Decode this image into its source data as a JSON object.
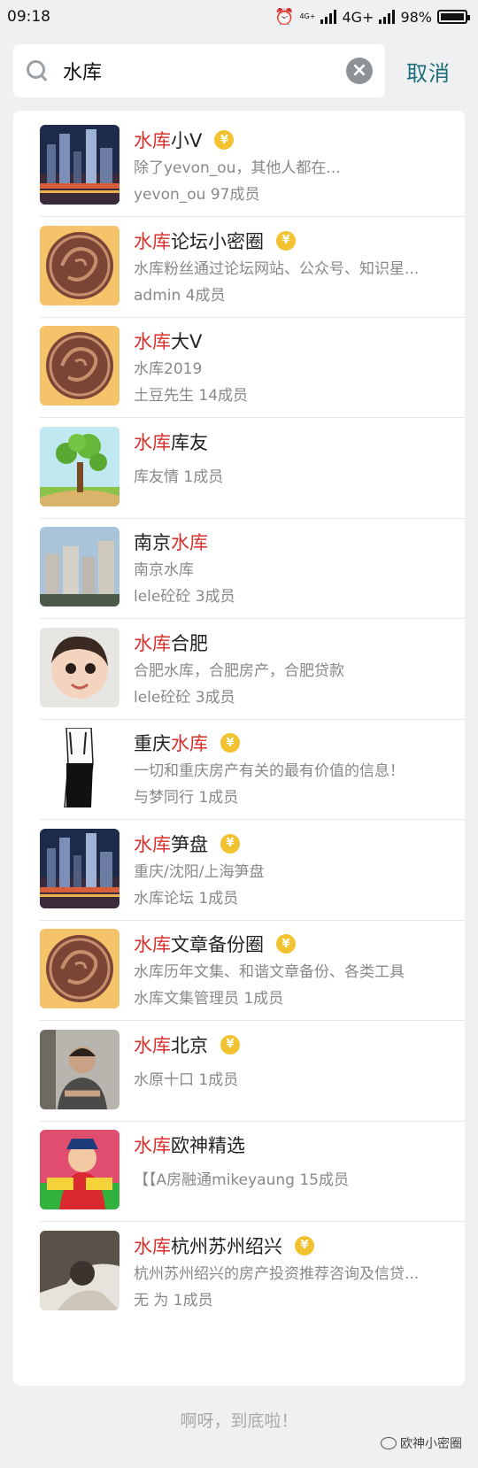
{
  "status_bar": {
    "time": "09:18",
    "network_small": "4G+",
    "network": "4G+",
    "battery": "98%"
  },
  "search": {
    "value": "水库",
    "cancel_label": "取消"
  },
  "items": [
    {
      "highlight": "水库",
      "title_rest": "小V",
      "prefix": "",
      "verified": true,
      "desc": "除了yevon_ou，其他人都在...",
      "meta": "yevon_ou 97成员"
    },
    {
      "highlight": "水库",
      "title_rest": "论坛小密圈",
      "prefix": "",
      "verified": true,
      "desc": "水库粉丝通过论坛网站、公众号、知识星...",
      "meta": "admin 4成员"
    },
    {
      "highlight": "水库",
      "title_rest": "大V",
      "prefix": "",
      "verified": false,
      "desc": "水库2019",
      "meta": "土豆先生 14成员"
    },
    {
      "highlight": "水库",
      "title_rest": "库友",
      "prefix": "",
      "verified": false,
      "desc": "",
      "meta": "库友情 1成员"
    },
    {
      "highlight": "水库",
      "title_rest": "",
      "prefix": "南京",
      "verified": false,
      "desc": "南京水库",
      "meta": "lele砼砼 3成员"
    },
    {
      "highlight": "水库",
      "title_rest": "合肥",
      "prefix": "",
      "verified": false,
      "desc": "合肥水库，合肥房产，合肥贷款",
      "meta": "lele砼砼 3成员"
    },
    {
      "highlight": "水库",
      "title_rest": "",
      "prefix": "重庆",
      "verified": true,
      "desc": "一切和重庆房产有关的最有价值的信息！",
      "meta": "与梦同行 1成员"
    },
    {
      "highlight": "水库",
      "title_rest": "笋盘",
      "prefix": "",
      "verified": true,
      "desc": "重庆/沈阳/上海笋盘",
      "meta": "水库论坛 1成员"
    },
    {
      "highlight": "水库",
      "title_rest": "文章备份圈",
      "prefix": "",
      "verified": true,
      "desc": "水库历年文集、和谐文章备份、各类工具",
      "meta": "水库文集管理员 1成员"
    },
    {
      "highlight": "水库",
      "title_rest": "北京",
      "prefix": "",
      "verified": true,
      "desc": "",
      "meta": "水原十口 1成员"
    },
    {
      "highlight": "水库",
      "title_rest": "欧神精选",
      "prefix": "",
      "verified": false,
      "desc": "",
      "meta": "【【A房融通mikeyaung 15成员"
    },
    {
      "highlight": "水库",
      "title_rest": "杭州苏州绍兴",
      "prefix": "",
      "verified": true,
      "desc": "杭州苏州绍兴的房产投资推荐咨询及信贷...",
      "meta": "无 为 1成员"
    }
  ],
  "verified_symbol": "¥",
  "footer": "啊呀，到底啦！",
  "watermark": "欧神小密圈"
}
